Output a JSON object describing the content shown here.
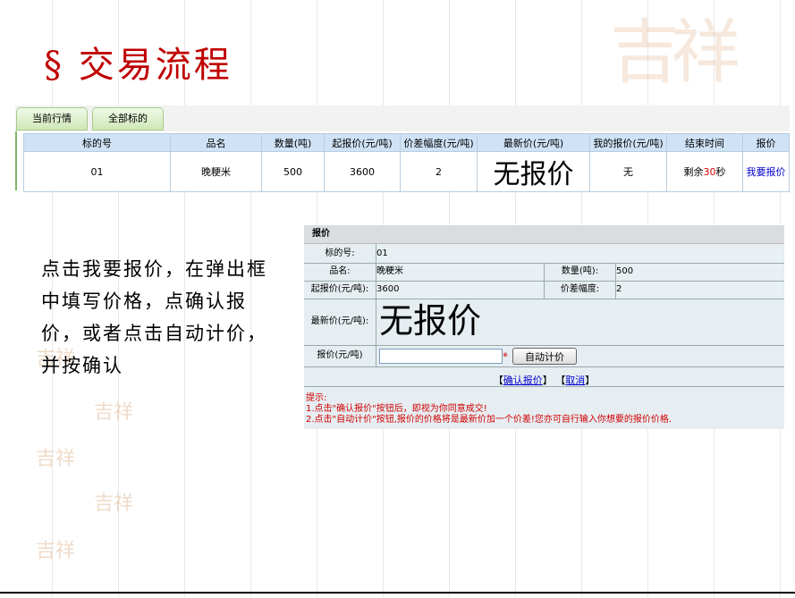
{
  "slide": {
    "title": "§ 交易流程",
    "instruction": "点击我要报价，在弹出框中填写价格，点确认报价，或者点击自动计价，并按确认",
    "seal_text": "吉祥"
  },
  "tabs": [
    {
      "label": "当前行情"
    },
    {
      "label": "全部标的"
    }
  ],
  "quote_table": {
    "headers": [
      "标的号",
      "品名",
      "数量(吨)",
      "起报价(元/吨)",
      "价差幅度(元/吨)",
      "最新价(元/吨)",
      "我的报价(元/吨)",
      "结束时间",
      "报价"
    ],
    "row": {
      "lot_no": "01",
      "product": "晚粳米",
      "quantity": "500",
      "start_price": "3600",
      "price_step": "2",
      "latest_price": "无报价",
      "my_quote": "无",
      "end_prefix": "剩余",
      "end_seconds": "30",
      "end_suffix": "秒",
      "action": "我要报价"
    }
  },
  "dialog": {
    "title": "报价",
    "lot_label": "标的号:",
    "lot_value": "01",
    "product_label": "品名:",
    "product_value": "晚粳米",
    "qty_label": "数量(吨):",
    "qty_value": "500",
    "start_label": "起报价(元/吨):",
    "start_value": "3600",
    "step_label": "价差幅度:",
    "step_value": "2",
    "latest_label": "最新价(元/吨):",
    "latest_value": "无报价",
    "quote_label": "报价(元/吨)",
    "quote_input_value": "",
    "required_mark": "*",
    "auto_button": "自动计价",
    "bracket_open": "【",
    "bracket_close": "】",
    "confirm_link": "确认报价",
    "cancel_link": "取消",
    "hint_title": "提示:",
    "hint_1": "1.点击\"确认报价\"按钮后，即视为你同意成交!",
    "hint_2": "2.点击\"自动计价\"按钮,报价的价格将是最新价加一个价差!您亦可自行输入你想要的报价价格."
  },
  "colors": {
    "title": "#c00000",
    "header_bg": "#cfe2f6",
    "dialog_bg": "#e6eef2",
    "hint": "#d00000",
    "link": "#0000cc"
  }
}
